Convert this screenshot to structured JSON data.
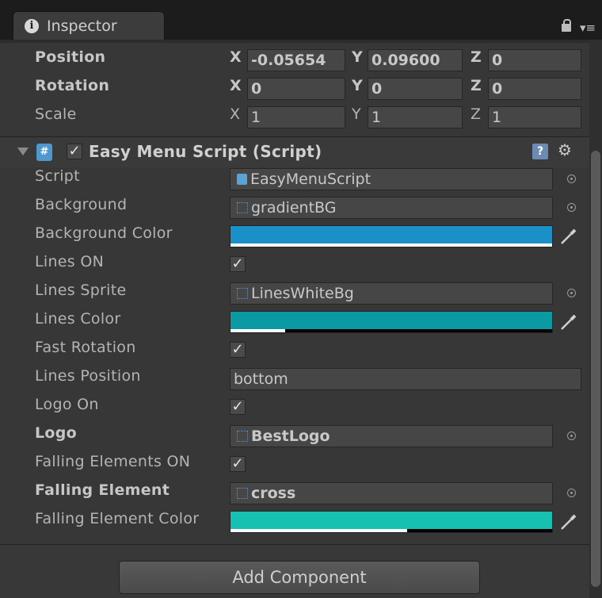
{
  "tab": {
    "title": "Inspector"
  },
  "transform": {
    "position": {
      "label": "Position",
      "x": "-0.05654",
      "y": "0.09600",
      "z": "0"
    },
    "rotation": {
      "label": "Rotation",
      "x": "0",
      "y": "0",
      "z": "0"
    },
    "scale": {
      "label": "Scale",
      "x": "1",
      "y": "1",
      "z": "1"
    }
  },
  "axis": {
    "x": "X",
    "y": "Y",
    "z": "Z"
  },
  "component": {
    "title": "Easy Menu Script (Script)",
    "enabled_mark": "✓",
    "help_glyph": "?",
    "gear_glyph": "⚙"
  },
  "fields": {
    "script": {
      "label": "Script",
      "value": "EasyMenuScript"
    },
    "background": {
      "label": "Background",
      "value": "gradientBG"
    },
    "background_color": {
      "label": "Background Color",
      "color": "#1a8fc8",
      "alpha": 1.0
    },
    "lines_on": {
      "label": "Lines ON",
      "checked": "✓"
    },
    "lines_sprite": {
      "label": "Lines Sprite",
      "value": "LinesWhiteBg"
    },
    "lines_color": {
      "label": "Lines Color",
      "color": "#0b9aa3",
      "alpha": 0.17
    },
    "fast_rotation": {
      "label": "Fast Rotation",
      "checked": "✓"
    },
    "lines_position": {
      "label": "Lines Position",
      "value": "bottom"
    },
    "logo_on": {
      "label": "Logo On",
      "checked": "✓"
    },
    "logo": {
      "label": "Logo",
      "value": "BestLogo"
    },
    "falling_elements_on": {
      "label": "Falling Elements ON",
      "checked": "✓"
    },
    "falling_element": {
      "label": "Falling Element",
      "value": "cross"
    },
    "falling_element_color": {
      "label": "Falling Element Color",
      "color": "#16c1b2",
      "alpha": 0.55
    }
  },
  "add_component": {
    "label": "Add Component"
  },
  "icons": [
    "info-icon",
    "lock-icon",
    "menu-icon",
    "fold-icon",
    "csharp-script-icon",
    "help-icon",
    "gear-icon",
    "object-picker-icon",
    "eyedropper-icon",
    "checkmark-icon"
  ]
}
